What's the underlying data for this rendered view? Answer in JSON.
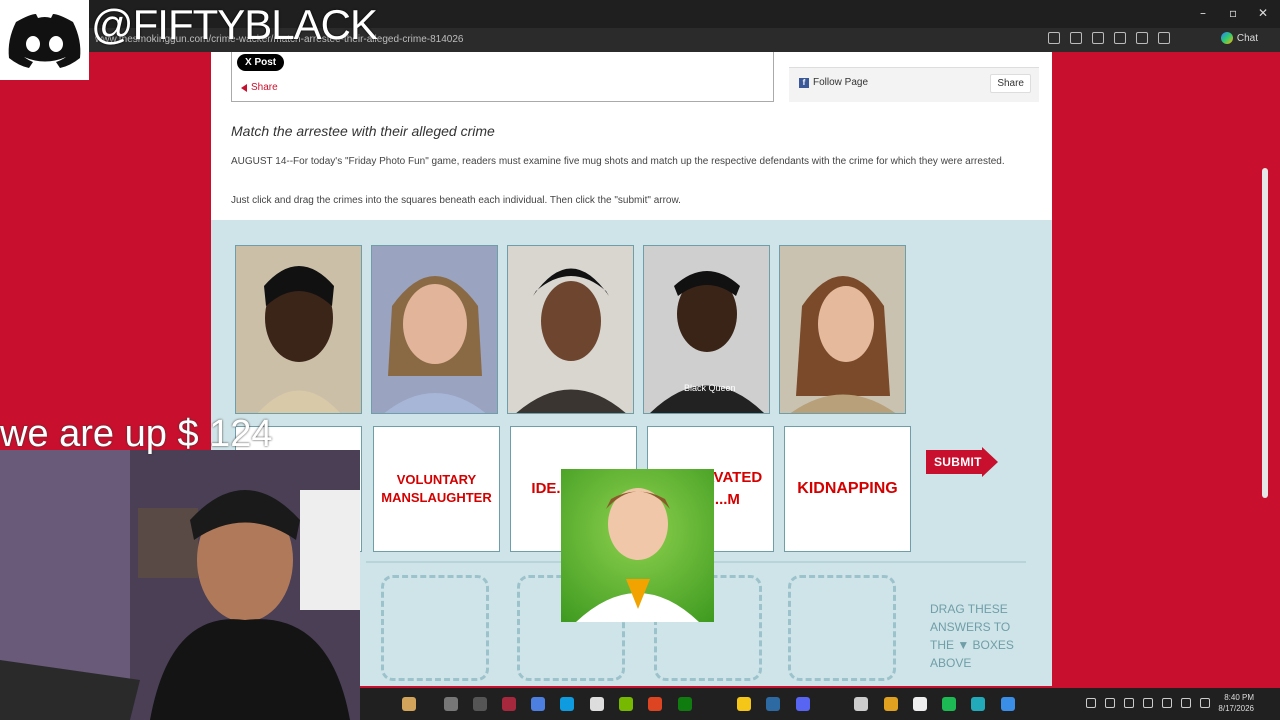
{
  "browser": {
    "url": "www.thesmokinggun.com/crime-wacker/match-arrestee-their-alleged-crime-814026",
    "chat_label": "Chat",
    "window_controls": [
      "–",
      "▫",
      "✕"
    ]
  },
  "social": {
    "post_label": "X Post",
    "share_label": "Share",
    "follow_label": "Follow Page",
    "fb_share_label": "Share"
  },
  "article": {
    "headline": "Match the arrestee with their alleged crime",
    "paragraph1": "AUGUST 14--For today's \"Friday Photo Fun\" game, readers must examine five mug shots and match up the respective defendants with the crime for which they were arrested.",
    "paragraph2": "Just click and drag the crimes into the squares beneath each individual. Then click the \"submit\" arrow."
  },
  "game": {
    "crimes": [
      {
        "label": ""
      },
      {
        "label": "VOLUNTARY MANSLAUGHTER"
      },
      {
        "label": "IDE... THE..."
      },
      {
        "label": "AGGRAVATED ...LT ...M"
      },
      {
        "label": "KIDNAPPING"
      }
    ],
    "submit_label": "SUBMIT",
    "drag_note": "DRAG THESE ANSWERS TO THE ▼ BOXES ABOVE",
    "mug_colors": [
      "#cbbfa7",
      "#9aa3c0",
      "#3a3530",
      "#222222",
      "#b8a07a"
    ]
  },
  "overlay": {
    "handle": "@FIFTYBLACK",
    "money_text": "we are up $ 124"
  },
  "taskbar": {
    "time": "8:40 PM",
    "date": "8/17/2026"
  }
}
